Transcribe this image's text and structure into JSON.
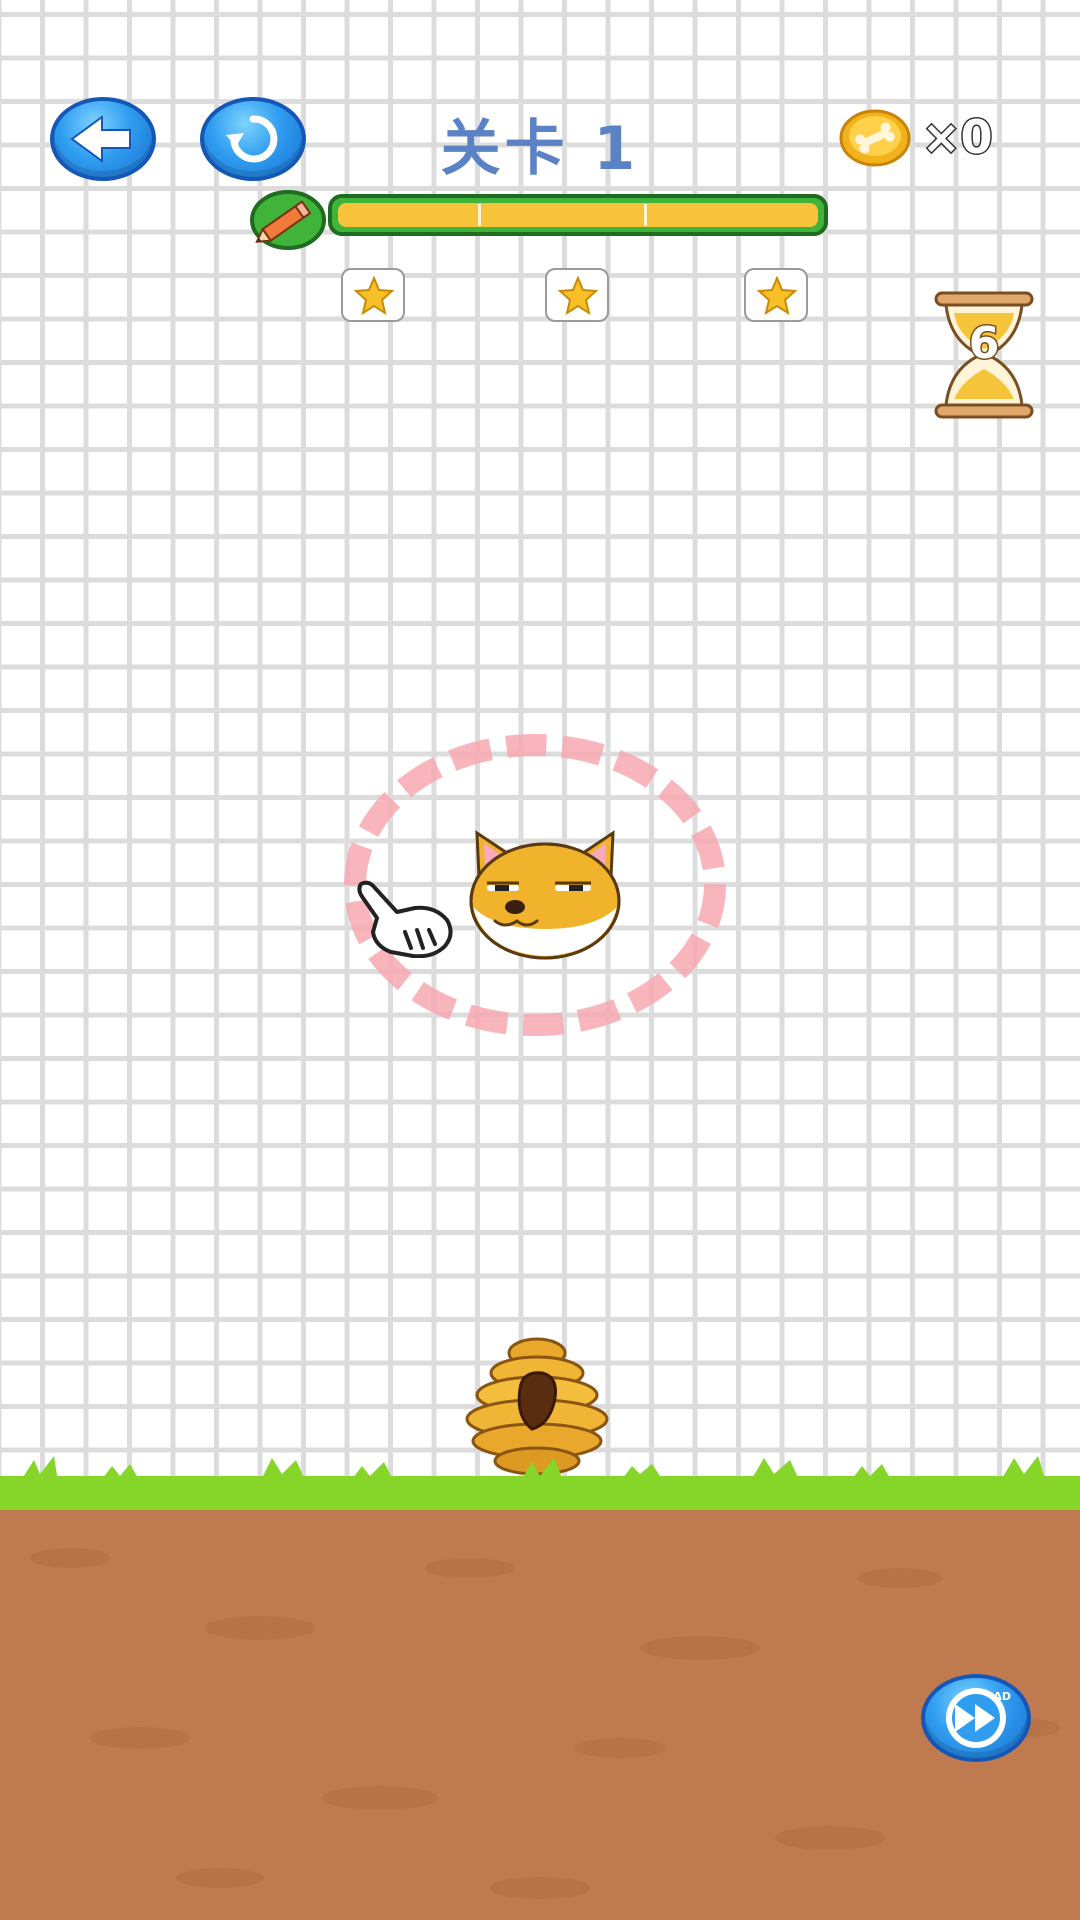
{
  "header": {
    "level_title": "关卡 1",
    "coin_count": "×0"
  },
  "ink_bar": {
    "fill_fraction": 1.0
  },
  "stars": {
    "count": 3
  },
  "timer": {
    "value": "6"
  },
  "skip_button": {
    "ad_label": "AD"
  },
  "colors": {
    "grid": "#dcdcdc",
    "title": "#5b82c4",
    "bar_green": "#3fb33a",
    "bar_yellow": "#f7c33a",
    "ground": "#c07a4f",
    "grass": "#86d62a",
    "button_blue": "#2f9df0"
  }
}
